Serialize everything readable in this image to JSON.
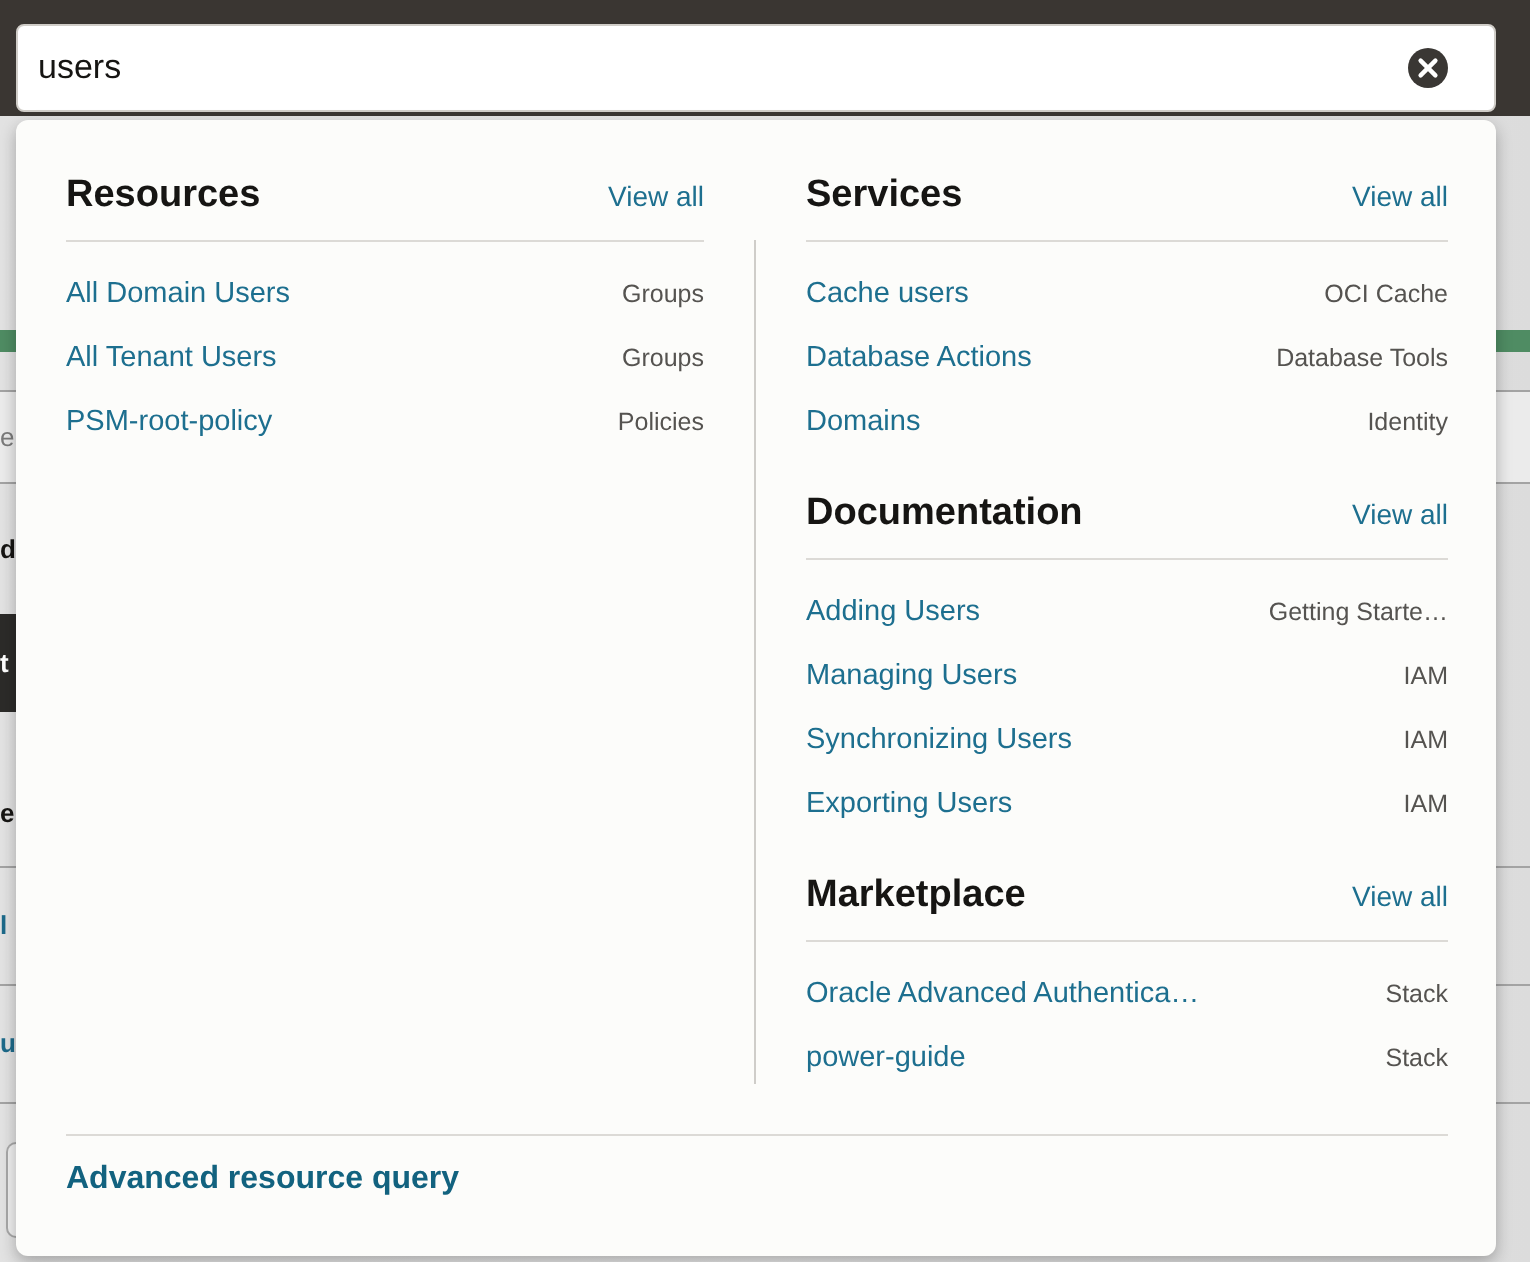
{
  "search": {
    "value": "users"
  },
  "results": {
    "columns": [
      {
        "sections": [
          {
            "title": "Resources",
            "view_all": "View all",
            "items": [
              {
                "label": "All Domain Users",
                "category": "Groups"
              },
              {
                "label": "All Tenant Users",
                "category": "Groups"
              },
              {
                "label": "PSM-root-policy",
                "category": "Policies"
              }
            ]
          }
        ]
      },
      {
        "sections": [
          {
            "title": "Services",
            "view_all": "View all",
            "items": [
              {
                "label": "Cache users",
                "category": "OCI Cache"
              },
              {
                "label": "Database Actions",
                "category": "Database Tools"
              },
              {
                "label": "Domains",
                "category": "Identity"
              }
            ]
          },
          {
            "title": "Documentation",
            "view_all": "View all",
            "items": [
              {
                "label": "Adding Users",
                "category": "Getting Starte…"
              },
              {
                "label": "Managing Users",
                "category": "IAM"
              },
              {
                "label": "Synchronizing Users",
                "category": "IAM"
              },
              {
                "label": "Exporting Users",
                "category": "IAM"
              }
            ]
          },
          {
            "title": "Marketplace",
            "view_all": "View all",
            "items": [
              {
                "label": "Oracle Advanced Authentica…",
                "category": "Stack"
              },
              {
                "label": "power-guide",
                "category": "Stack"
              }
            ]
          }
        ]
      }
    ],
    "footer_link": "Advanced resource query"
  },
  "background": {
    "fragments": [
      {
        "text": "e",
        "kind": "hint"
      },
      {
        "text": "d",
        "kind": "heading"
      },
      {
        "text": "t",
        "kind": "button"
      },
      {
        "text": "e",
        "kind": "heading"
      },
      {
        "text": "l",
        "kind": "link"
      },
      {
        "text": "u",
        "kind": "link"
      }
    ]
  }
}
